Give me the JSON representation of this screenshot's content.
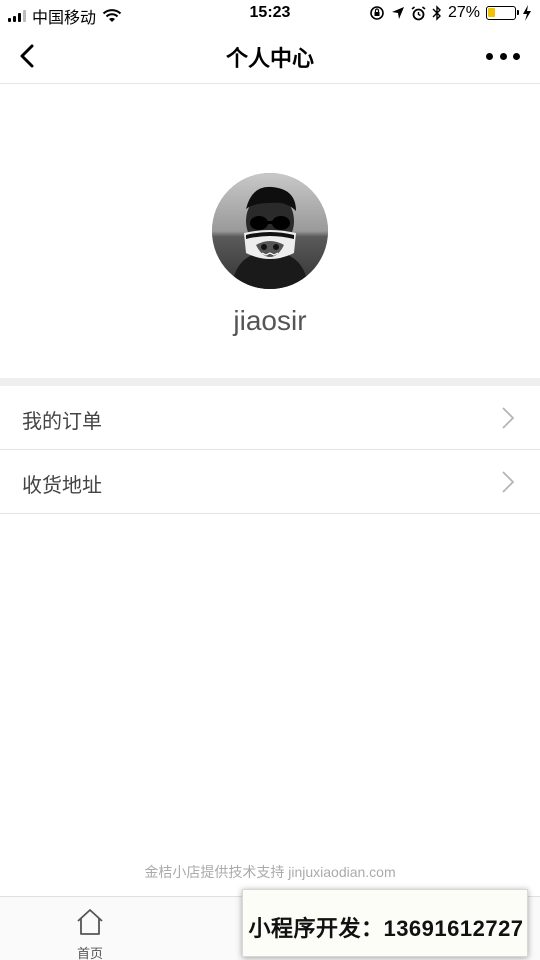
{
  "status_bar": {
    "carrier": "中国移动",
    "time": "15:23",
    "battery_percent": "27%",
    "battery_level": 0.27,
    "icons": [
      "signal-icon",
      "wifi-icon",
      "orientation-lock-icon",
      "location-icon",
      "alarm-icon",
      "bluetooth-icon",
      "battery-icon",
      "charging-icon"
    ]
  },
  "nav": {
    "title": "个人中心",
    "back_icon": "chevron-left-icon",
    "more_icon": "more-dots-icon"
  },
  "profile": {
    "username": "jiaosir",
    "avatar_icon": "avatar-photo"
  },
  "menu": {
    "items": [
      {
        "label": "我的订单",
        "icon": "chevron-right-icon"
      },
      {
        "label": "收货地址",
        "icon": "chevron-right-icon"
      }
    ]
  },
  "footer": {
    "note": "金桔小店提供技术支持 jinjuxiaodian.com"
  },
  "tab_bar": {
    "tabs": [
      {
        "label": "首页",
        "icon": "home-icon"
      }
    ]
  },
  "dev_badge": {
    "text": "小程序开发：13691612727"
  },
  "colors": {
    "battery_fill": "#f2c200",
    "divider": "#e5e5e5",
    "section_gap": "#efefef"
  }
}
